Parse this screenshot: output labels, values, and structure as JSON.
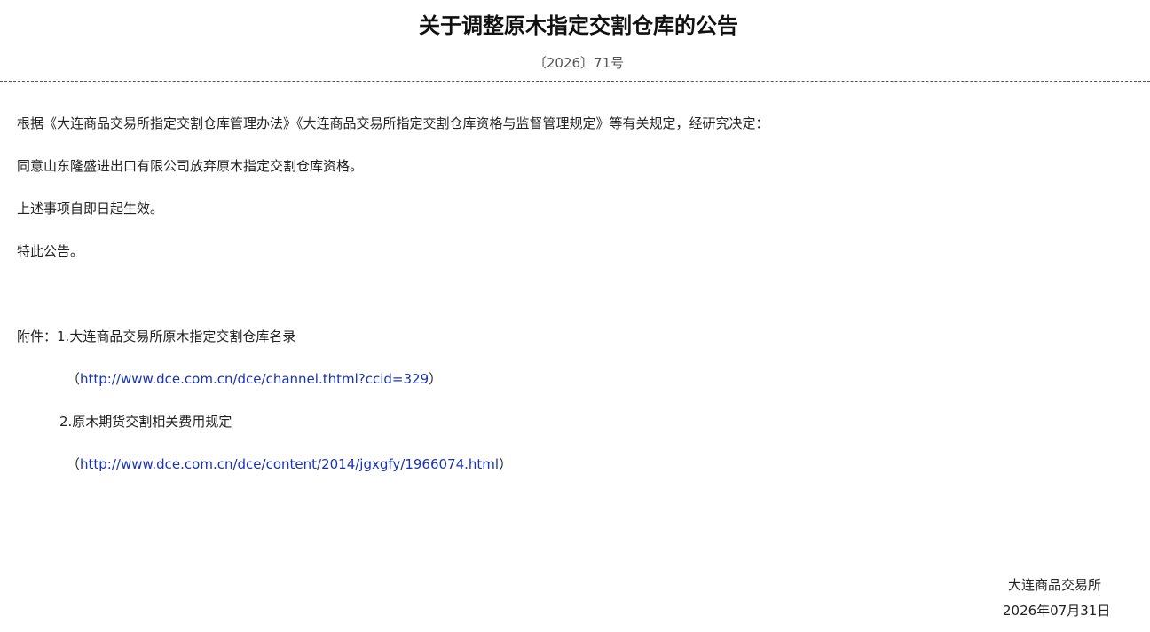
{
  "header": {
    "title": "关于调整原木指定交割仓库的公告",
    "doc_number": "〔2026〕71号"
  },
  "body": {
    "paragraphs": [
      "根据《大连商品交易所指定交割仓库管理办法》《大连商品交易所指定交割仓库资格与监督管理规定》等有关规定，经研究决定：",
      "同意山东隆盛进出口有限公司放弃原木指定交割仓库资格。",
      "上述事项自即日起生效。",
      "特此公告。"
    ]
  },
  "attachments": {
    "prefix": "附件：",
    "items": [
      {
        "label": "1.大连商品交易所原木指定交割仓库名录",
        "open_paren": "（",
        "url": "http://www.dce.com.cn/dce/channel.thtml?ccid=329",
        "close_paren": "）"
      },
      {
        "label": "2.原木期货交割相关费用规定",
        "open_paren": "（",
        "url": "http://www.dce.com.cn/dce/content/2014/jgxgfy/1966074.html",
        "close_paren": "）"
      }
    ]
  },
  "signature": {
    "organization": "大连商品交易所",
    "date": "2026年07月31日"
  },
  "colors": {
    "link": "#1a33b3",
    "text": "#222222",
    "muted": "#555555"
  }
}
